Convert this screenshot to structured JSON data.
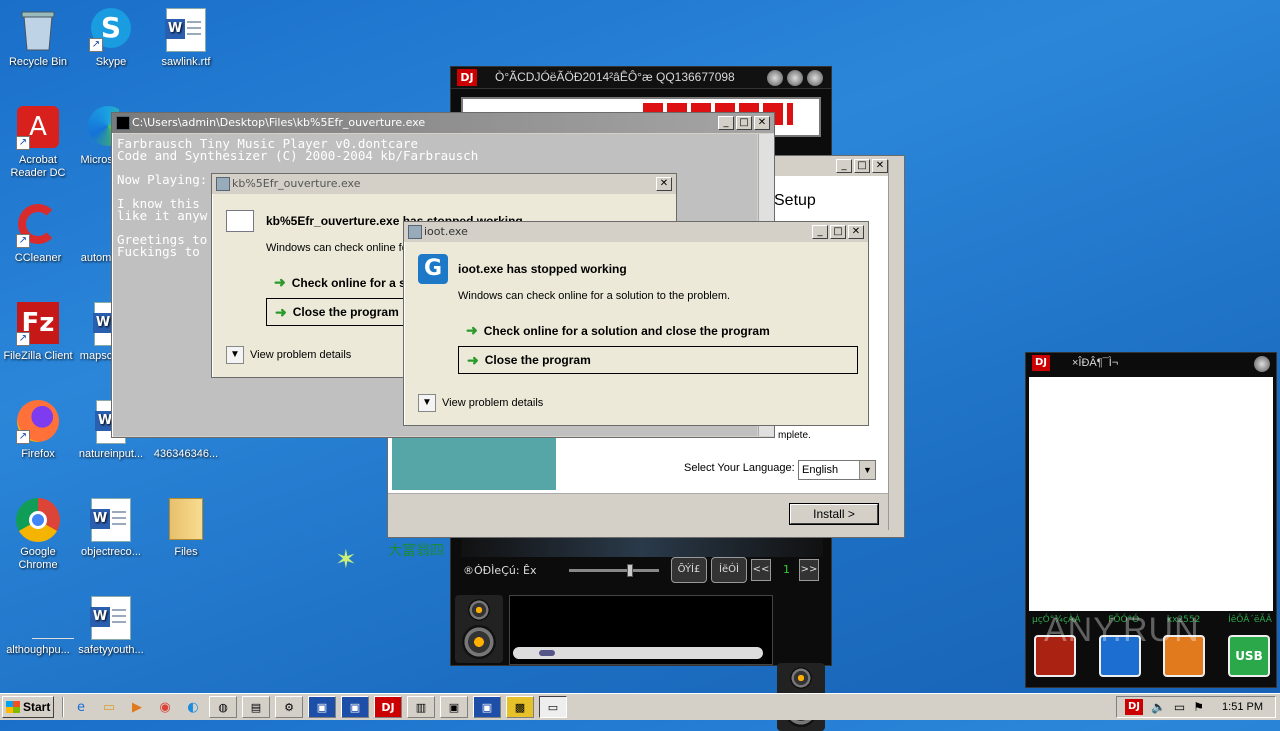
{
  "desktop_icons": [
    {
      "label": "Recycle Bin",
      "icon": "recycle-bin-icon"
    },
    {
      "label": "Skype",
      "icon": "skype-icon"
    },
    {
      "label": "sawlink.rtf",
      "icon": "word-doc-icon"
    },
    {
      "label": "Acrobat Reader DC",
      "icon": "acrobat-icon"
    },
    {
      "label": "Microso",
      "icon": "edge-icon"
    },
    {
      "label": "CCleaner",
      "icon": "ccleaner-icon"
    },
    {
      "label": "autom",
      "icon": "word-doc-icon"
    },
    {
      "label": "FileZilla Client",
      "icon": "filezilla-icon"
    },
    {
      "label": "mapsc",
      "icon": "word-doc-icon"
    },
    {
      "label": "Firefox",
      "icon": "firefox-icon"
    },
    {
      "label": "natureinput...",
      "icon": "word-doc-icon"
    },
    {
      "label": "436346346...",
      "icon": "file-icon"
    },
    {
      "label": "Google Chrome",
      "icon": "chrome-icon"
    },
    {
      "label": "objectreco...",
      "icon": "word-doc-icon"
    },
    {
      "label": "Files",
      "icon": "folder-icon"
    },
    {
      "label": "althoughpu...",
      "icon": "file-icon"
    },
    {
      "label": "safetyyouth...",
      "icon": "word-doc-icon"
    }
  ],
  "console": {
    "title": "C:\\Users\\admin\\Desktop\\Files\\kb%5Efr_ouverture.exe",
    "lines": "Farbrausch Tiny Music Player v0.dontcare\nCode and Synthesizer (C) 2000-2004 kb/Farbrausch\n\nNow Playing:\n\nI know this\nlike it anyw\n\nGreetings to\nFuckings to"
  },
  "dialog_kb": {
    "title": "kb%5Efr_ouverture.exe",
    "heading": "kb%5Efr_ouverture.exe has stopped working",
    "sub": "Windows can check online fo",
    "check": "Check online for a s",
    "close": "Close the program",
    "details": "View problem details"
  },
  "dialog_ioot": {
    "title": "ioot.exe",
    "heading": "ioot.exe has stopped working",
    "sub": "Windows can check online for a solution to the problem.",
    "check": "Check online for a solution and close the program",
    "close": "Close the program",
    "details": "View problem details"
  },
  "setup": {
    "heading": "Setup",
    "complete": "mplete.",
    "language_label": "Select Your Language:",
    "language_value": "English",
    "install": "Install >",
    "footer_cn": "大富翁四"
  },
  "dj_player": {
    "title": "Ò°ÃCDJÓëÃÖÐ2014²âÊÔ°æ QQ136677098",
    "status": "®ÓÐÌeÇú: Êx",
    "btn1": "ÕÝÍ£",
    "btn2": "ÍëÓÌ",
    "prev": "<<",
    "num": "1",
    "next": ">>"
  },
  "dj_small": {
    "title": "×ÎÐÂ¶¯Ì¬",
    "tabs": [
      "µçÓ°¾çÀÀ",
      "FÕÓ°Ó",
      "kx2552",
      "ÍêÕÂ´ëÃÂ"
    ],
    "watermark": "ANY.RUN"
  },
  "taskbar": {
    "start": "Start",
    "time": "1:51 PM"
  }
}
